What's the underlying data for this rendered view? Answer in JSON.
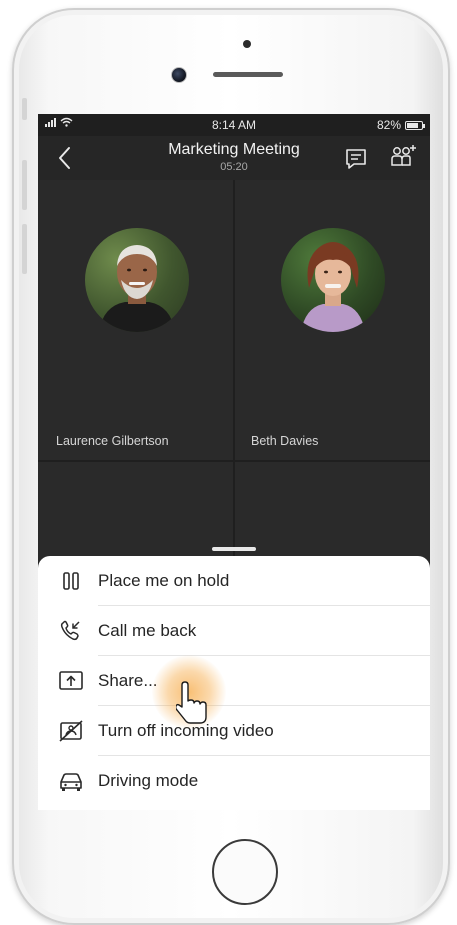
{
  "status_bar": {
    "time": "8:14 AM",
    "battery": "82%",
    "battery_level": 0.82
  },
  "header": {
    "title": "Marketing Meeting",
    "timer": "05:20",
    "icons": [
      "back-arrow-icon",
      "chat-icon",
      "add-people-icon"
    ]
  },
  "participants": [
    {
      "name": "Laurence Gilbertson"
    },
    {
      "name": "Beth Davies"
    }
  ],
  "menu": {
    "items": [
      {
        "label": "Place me on hold",
        "icon": "pause-icon"
      },
      {
        "label": "Call me back",
        "icon": "callback-icon"
      },
      {
        "label": "Share...",
        "icon": "share-icon"
      },
      {
        "label": "Turn off incoming video",
        "icon": "video-off-icon"
      },
      {
        "label": "Driving mode",
        "icon": "car-icon"
      }
    ]
  },
  "colors": {
    "screen_bg": "#1f1f1f",
    "tile_bg": "#2a2a2a",
    "sheet_bg": "#ffffff",
    "highlight_glow": "#f6aa46"
  }
}
